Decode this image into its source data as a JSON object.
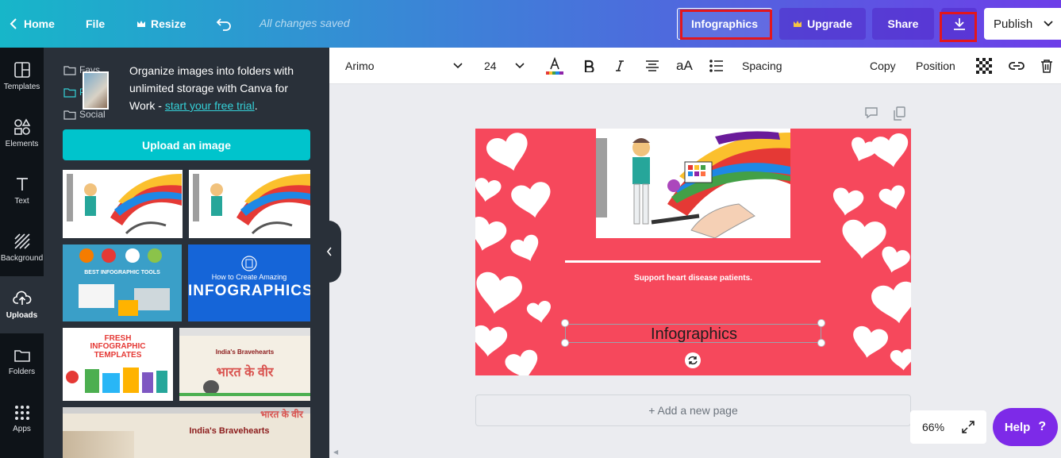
{
  "header": {
    "back_label": "Home",
    "file_label": "File",
    "resize_label": "Resize",
    "saved_status": "All changes saved",
    "doc_title": "Infographics",
    "upgrade_label": "Upgrade",
    "share_label": "Share",
    "publish_label": "Publish"
  },
  "rail": {
    "items": [
      {
        "label": "Templates",
        "icon": "templates-icon"
      },
      {
        "label": "Elements",
        "icon": "elements-icon"
      },
      {
        "label": "Text",
        "icon": "text-icon"
      },
      {
        "label": "Background",
        "icon": "background-icon"
      },
      {
        "label": "Uploads",
        "icon": "upload-icon",
        "active": true
      },
      {
        "label": "Folders",
        "icon": "folder-icon"
      },
      {
        "label": "Apps",
        "icon": "apps-icon"
      }
    ]
  },
  "panel": {
    "folders": [
      "Favs",
      "Pur",
      "Social"
    ],
    "promo_text": "Organize images into folders with unlimited storage with Canva for Work - ",
    "promo_link": "start your free trial",
    "promo_end": ".",
    "upload_label": "Upload an image",
    "thumbs": [
      {
        "caption": ""
      },
      {
        "caption": ""
      },
      {
        "caption": "BEST INFOGRAPHIC TOOLS"
      },
      {
        "caption": "How to Create Amazing",
        "big": "INFOGRAPHICS"
      },
      {
        "caption": "FRESH",
        "big": "INFOGRAPHIC TEMPLATES"
      },
      {
        "caption": "India's Bravehearts",
        "big": "भारत के वीर"
      },
      {
        "caption": "India's Bravehearts",
        "big": "भारत के वीर"
      }
    ]
  },
  "toolbar": {
    "font": "Arimo",
    "size": "24",
    "spacing_label": "Spacing",
    "copy_label": "Copy",
    "position_label": "Position",
    "case_label": "aA"
  },
  "canvas": {
    "support_text": "Support heart disease patients.",
    "selected_text": "Infographics",
    "add_page_label": "+ Add a new page",
    "zoom_label": "66%",
    "help_label": "Help",
    "help_mark": "?"
  },
  "colors": {
    "accent": "#00c4cc",
    "design_bg": "#f6485c",
    "help_bg": "#7d2ae8",
    "highlight": "#e3161c"
  }
}
